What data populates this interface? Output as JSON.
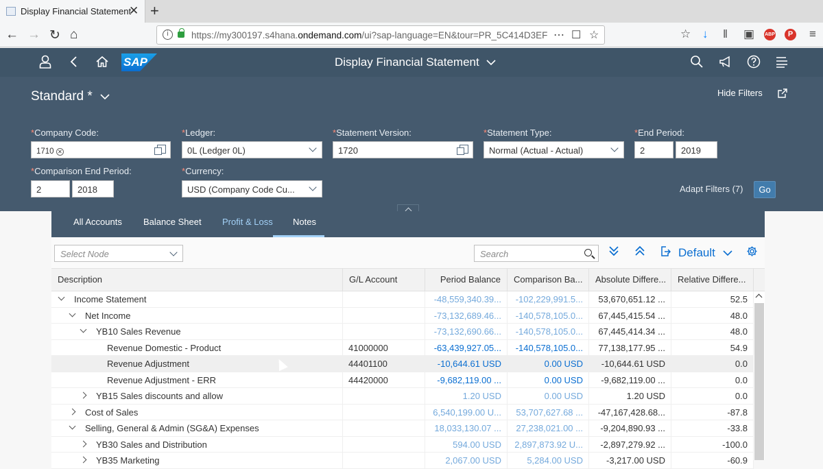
{
  "browser": {
    "tab_title": "Display Financial Statement",
    "url_host": "https://my300197.s4hana.",
    "url_domain": "ondemand.com",
    "url_rest": "/ui?sap-language=EN&tour=PR_5C414D3EF",
    "adblock_label": "ABP"
  },
  "shell": {
    "logo": "SAP",
    "title": "Display Financial Statement"
  },
  "filters": {
    "variant": "Standard *",
    "hide_filters": "Hide Filters",
    "company_code": {
      "label": "Company Code:",
      "token": "1710"
    },
    "ledger": {
      "label": "Ledger:",
      "value": "0L (Ledger 0L)"
    },
    "statement_version": {
      "label": "Statement Version:",
      "value": "1720"
    },
    "statement_type": {
      "label": "Statement Type:",
      "value": "Normal (Actual - Actual)"
    },
    "end_period": {
      "label": "End Period:",
      "period": "2",
      "year": "2019"
    },
    "comparison_end_period": {
      "label": "Comparison End Period:",
      "period": "2",
      "year": "2018"
    },
    "currency": {
      "label": "Currency:",
      "value": "USD (Company Code Cu..."
    },
    "adapt_filters": "Adapt Filters (7)",
    "go": "Go",
    "required_mark": "*"
  },
  "tabs": [
    {
      "label": "All Accounts",
      "selected": false
    },
    {
      "label": "Balance Sheet",
      "selected": false
    },
    {
      "label": "Profit & Loss",
      "selected": true
    },
    {
      "label": "Notes",
      "selected": false
    }
  ],
  "toolbar": {
    "select_node_placeholder": "Select Node",
    "search_placeholder": "Search",
    "variant": "Default"
  },
  "table": {
    "columns": [
      "Description",
      "G/L Account",
      "Period Balance",
      "Comparison Ba...",
      "Absolute Differe...",
      "Relative Differe..."
    ],
    "rows": [
      {
        "level": 0,
        "expand": "down",
        "desc": "Income Statement",
        "gl": "",
        "period": "-48,559,340.39...",
        "comparison": "-102,229,991.5...",
        "absolute": "53,670,651.12 ...",
        "relative": "52.5",
        "style": "light"
      },
      {
        "level": 1,
        "expand": "down",
        "desc": "Net Income",
        "gl": "",
        "period": "-73,132,689.46...",
        "comparison": "-140,578,105.0...",
        "absolute": "67,445,415.54 ...",
        "relative": "48.0",
        "style": "light"
      },
      {
        "level": 2,
        "expand": "down",
        "desc": "YB10 Sales Revenue",
        "gl": "",
        "period": "-73,132,690.66...",
        "comparison": "-140,578,105.0...",
        "absolute": "67,445,414.34 ...",
        "relative": "48.0",
        "style": "light"
      },
      {
        "level": 3,
        "expand": "none",
        "desc": "Revenue Domestic - Product",
        "gl": "41000000",
        "period": "-63,439,927.05...",
        "comparison": "-140,578,105.0...",
        "absolute": "77,138,177.95 ...",
        "relative": "54.9",
        "style": "link"
      },
      {
        "level": 3,
        "expand": "none",
        "desc": "Revenue Adjustment",
        "gl": "44401100",
        "period": "-10,644.61 USD",
        "comparison": "0.00 USD",
        "absolute": "-10,644.61 USD",
        "relative": "0.0",
        "style": "link",
        "highlight": true
      },
      {
        "level": 3,
        "expand": "none",
        "desc": "Revenue Adjustment - ERR",
        "gl": "44420000",
        "period": "-9,682,119.00 ...",
        "comparison": "0.00 USD",
        "absolute": "-9,682,119.00 ...",
        "relative": "0.0",
        "style": "link"
      },
      {
        "level": 2,
        "expand": "right",
        "desc": "YB15 Sales discounts and allow",
        "gl": "",
        "period": "1.20 USD",
        "comparison": "0.00 USD",
        "absolute": "1.20 USD",
        "relative": "0.0",
        "style": "light"
      },
      {
        "level": 1,
        "expand": "right",
        "desc": "Cost of Sales",
        "gl": "",
        "period": "6,540,199.00 U...",
        "comparison": "53,707,627.68 ...",
        "absolute": "-47,167,428.68...",
        "relative": "-87.8",
        "style": "light"
      },
      {
        "level": 1,
        "expand": "down",
        "desc": "Selling, General & Admin (SG&A) Expenses",
        "gl": "",
        "period": "18,033,130.07 ...",
        "comparison": "27,238,021.00 ...",
        "absolute": "-9,204,890.93 ...",
        "relative": "-33.8",
        "style": "light"
      },
      {
        "level": 2,
        "expand": "right",
        "desc": "YB30 Sales and Distribution",
        "gl": "",
        "period": "594.00 USD",
        "comparison": "2,897,873.92 U...",
        "absolute": "-2,897,279.92 ...",
        "relative": "-100.0",
        "style": "light"
      },
      {
        "level": 2,
        "expand": "right",
        "desc": "YB35 Marketing",
        "gl": "",
        "period": "2,067.00 USD",
        "comparison": "5,284.00 USD",
        "absolute": "-3,217.00 USD",
        "relative": "-60.9",
        "style": "light"
      }
    ]
  },
  "colors": {
    "shell": "#3f5568",
    "filterbar": "#455a6e",
    "link": "#0a6ed1",
    "light_link": "#74a9dc"
  }
}
